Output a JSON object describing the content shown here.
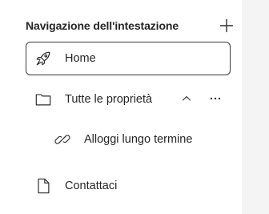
{
  "header": {
    "title": "Navigazione dell'intestazione",
    "add_icon": "plus-icon"
  },
  "nav": {
    "items": [
      {
        "label": "Home",
        "icon": "rocket-icon",
        "selected": true
      },
      {
        "label": "Tutte le proprietà",
        "icon": "folder-icon",
        "expanded": true,
        "collapse_icon": "chevron-up-icon",
        "more_icon": "more-horizontal-icon"
      },
      {
        "label": "Alloggi lungo termine",
        "icon": "link-icon",
        "nested": true
      },
      {
        "label": "Contattaci",
        "icon": "page-icon"
      }
    ]
  },
  "colors": {
    "text": "#262626",
    "selected_border": "#3a3a3a",
    "gutter": "#f4f4f4"
  }
}
